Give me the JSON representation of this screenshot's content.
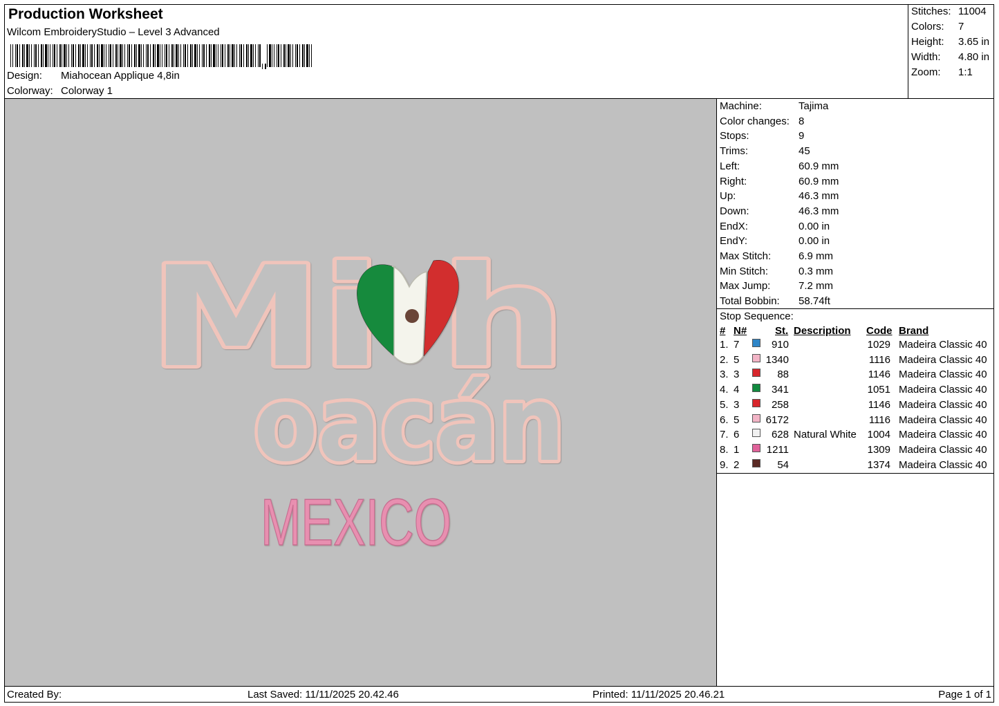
{
  "header": {
    "title": "Production Worksheet",
    "subtitle": "Wilcom EmbroideryStudio – Level 3 Advanced",
    "design_label": "Design:",
    "design_value": "Miahocean Applique 4,8in",
    "colorway_label": "Colorway:",
    "colorway_value": "Colorway 1"
  },
  "stats": [
    {
      "label": "Stitches:",
      "value": "11004"
    },
    {
      "label": "Colors:",
      "value": "7"
    },
    {
      "label": "Height:",
      "value": "3.65 in"
    },
    {
      "label": "Width:",
      "value": "4.80 in"
    },
    {
      "label": "Zoom:",
      "value": "1:1"
    }
  ],
  "machine_info": [
    {
      "label": "Machine:",
      "value": "Tajima"
    },
    {
      "label": "Color changes:",
      "value": "8"
    },
    {
      "label": "Stops:",
      "value": "9"
    },
    {
      "label": "Trims:",
      "value": "45"
    },
    {
      "label": "Left:",
      "value": "60.9 mm"
    },
    {
      "label": "Right:",
      "value": "60.9 mm"
    },
    {
      "label": "Up:",
      "value": "46.3 mm"
    },
    {
      "label": "Down:",
      "value": "46.3 mm"
    },
    {
      "label": "EndX:",
      "value": "0.00 in"
    },
    {
      "label": "EndY:",
      "value": "0.00 in"
    },
    {
      "label": "Max Stitch:",
      "value": "6.9 mm"
    },
    {
      "label": "Min Stitch:",
      "value": "0.3 mm"
    },
    {
      "label": "Max Jump:",
      "value": "7.2 mm"
    },
    {
      "label": "Total Bobbin:",
      "value": "58.74ft"
    }
  ],
  "stop_sequence": {
    "heading": "Stop Sequence:",
    "columns": {
      "num": "#",
      "n": "N#",
      "st": "St.",
      "desc": "Description",
      "code": "Code",
      "brand": "Brand"
    },
    "rows": [
      {
        "num": "1.",
        "n": "7",
        "st": "910",
        "desc": "",
        "code": "1029",
        "brand": "Madeira Classic 40",
        "color": "#2f86c8"
      },
      {
        "num": "2.",
        "n": "5",
        "st": "1340",
        "desc": "",
        "code": "1116",
        "brand": "Madeira Classic 40",
        "color": "#f2b4c6"
      },
      {
        "num": "3.",
        "n": "3",
        "st": "88",
        "desc": "",
        "code": "1146",
        "brand": "Madeira Classic 40",
        "color": "#d8262c"
      },
      {
        "num": "4.",
        "n": "4",
        "st": "341",
        "desc": "",
        "code": "1051",
        "brand": "Madeira Classic 40",
        "color": "#118a3f"
      },
      {
        "num": "5.",
        "n": "3",
        "st": "258",
        "desc": "",
        "code": "1146",
        "brand": "Madeira Classic 40",
        "color": "#d8262c"
      },
      {
        "num": "6.",
        "n": "5",
        "st": "6172",
        "desc": "",
        "code": "1116",
        "brand": "Madeira Classic 40",
        "color": "#f2b4c6"
      },
      {
        "num": "7.",
        "n": "6",
        "st": "628",
        "desc": "Natural White",
        "code": "1004",
        "brand": "Madeira Classic 40",
        "color": "#f1f1f1"
      },
      {
        "num": "8.",
        "n": "1",
        "st": "1211",
        "desc": "",
        "code": "1309",
        "brand": "Madeira Classic 40",
        "color": "#e0629a"
      },
      {
        "num": "9.",
        "n": "2",
        "st": "54",
        "desc": "",
        "code": "1374",
        "brand": "Madeira Classic 40",
        "color": "#5a2a24"
      }
    ]
  },
  "design_preview": {
    "line1": "Mi h",
    "line2": "oacán",
    "line3": "MEXICO",
    "outline_color": "#f0c4bb",
    "text_color": "#e88fb0",
    "flag_green": "#148a3c",
    "flag_white": "#f4f4ec",
    "flag_red": "#d22d2d",
    "emblem_color": "#6a4438"
  },
  "footer": {
    "created_by": "Created By:",
    "last_saved": "Last Saved: 11/11/2025 20.42.46",
    "printed": "Printed: 11/11/2025 20.46.21",
    "page": "Page 1 of 1"
  }
}
